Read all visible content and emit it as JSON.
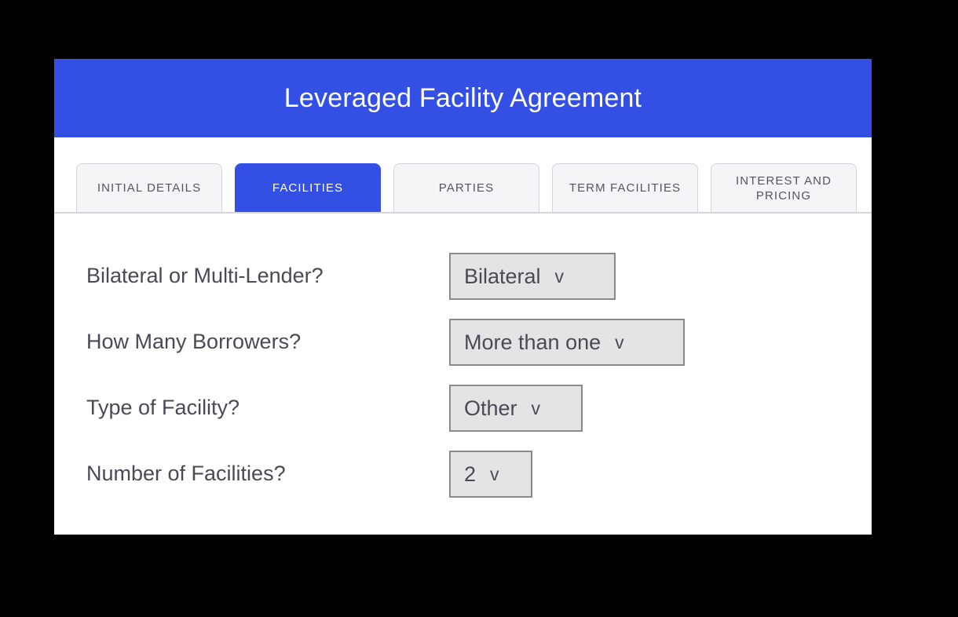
{
  "window": {
    "background_color": "#000000",
    "card_background": "#ffffff"
  },
  "header": {
    "title": "Leveraged Facility Agreement",
    "background_color": "#3450e4",
    "text_color": "#ffffff"
  },
  "tabs": {
    "active_index": 1,
    "items": [
      {
        "label": "INITIAL DETAILS",
        "active": false
      },
      {
        "label": "FACILITIES",
        "active": true
      },
      {
        "label": "PARTIES",
        "active": false
      },
      {
        "label": "TERM FACILITIES",
        "active": false
      },
      {
        "label": "INTEREST AND PRICING",
        "active": false
      }
    ]
  },
  "form": {
    "rows": [
      {
        "label": "Bilateral or Multi-Lender?",
        "value": "Bilateral",
        "caret": "v",
        "field_width": 212
      },
      {
        "label": "How Many Borrowers?",
        "value": "More than one",
        "caret": "v",
        "field_width": 300
      },
      {
        "label": "Type of Facility?",
        "value": "Other",
        "caret": "v",
        "field_width": 170
      },
      {
        "label": "Number of Facilities?",
        "value": "2",
        "caret": "v",
        "field_width": 106
      }
    ]
  },
  "colors": {
    "accent": "#3450e4",
    "tab_inactive_bg": "#f5f5f7",
    "tab_border": "#d4d4dc",
    "dropdown_bg": "#e4e4e4",
    "dropdown_border": "#8a8a8a",
    "text_primary": "#4a4a57"
  }
}
